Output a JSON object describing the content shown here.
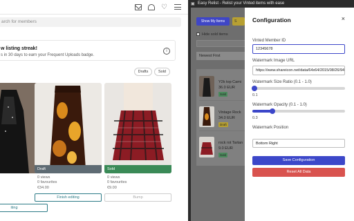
{
  "vinted": {
    "search_placeholder": "arch for members",
    "streak_title": "w listing streak!",
    "streak_subtitle": "s in 30 days to earn your Frequent Uploads badge.",
    "filters": [
      "Drafts",
      "Sold"
    ],
    "cards": [
      {
        "status": "",
        "views": "",
        "favourites": "",
        "price": "",
        "button": "iting"
      },
      {
        "status": "Draft",
        "views": "0 views",
        "favourites": "0 favourites",
        "price": "€34.00",
        "button": "Finish editing"
      },
      {
        "status": "Sold",
        "views": "0 views",
        "favourites": "0 favourites",
        "price": "€9.00",
        "button": "Bump"
      }
    ]
  },
  "extension": {
    "window_title": "Easy Relist - Relist your Vinted items with ease",
    "show_my_items": "Show My Items",
    "second_button": "S",
    "hide_sold": "Hide sold items",
    "sort": "Newest First",
    "items": [
      {
        "title": "Y2k top Cami",
        "price": "36.0 EUR",
        "badge": "Sold"
      },
      {
        "title": "Vintage Rock",
        "price": "34.0 EUR",
        "badge": "Draft"
      },
      {
        "title": "rock rot Tartan",
        "price": "9.0 EUR",
        "badge": "Sold"
      }
    ]
  },
  "config": {
    "title": "Configuration",
    "close": "×",
    "member_id_label": "Vinted Member ID",
    "member_id": "12345678",
    "watermark_url_label": "Watermark Image URL",
    "watermark_url": "https://www.shareicon.net/data/64x64/2015/08/26/941",
    "size_label": "Watermark Size Ratio (0.1 - 1.0)",
    "size_value": "0.1",
    "opacity_label": "Watermark Opacity (0.1 - 1.0)",
    "opacity_value": "0.3",
    "position_label": "Watermark Position",
    "position_value": "Bottom Right",
    "save_label": "Save Configuration",
    "reset_label": "Reset All Data"
  },
  "colors": {
    "accent": "#3c47c9",
    "danger": "#d9534f",
    "sold": "#3a8a57",
    "draft_badge": "#b7a032"
  }
}
